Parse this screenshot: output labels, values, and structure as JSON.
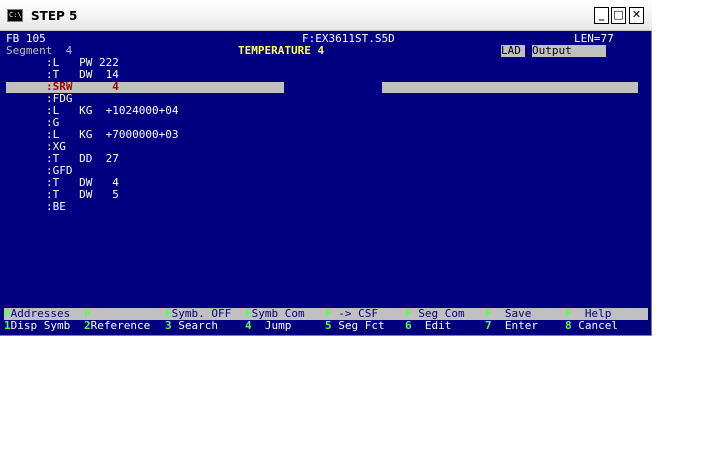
{
  "window": {
    "title": "STEP 5",
    "icon_text": "C:\\",
    "min": "_",
    "max": "□",
    "close": "✕"
  },
  "header": {
    "block": "FB 105",
    "file": "F:EX3611ST.S5D",
    "length": "LEN=77",
    "segment": "Segment  4",
    "segment_title": "TEMPERATURE 4",
    "mode": "LAD",
    "output": "Output"
  },
  "code_lines": [
    ":L   PW 222",
    ":T   DW  14",
    ":SRW      4",
    ":FDG",
    ":L   KG  +1024000+04",
    ":G",
    ":L   KG  +7000000+03",
    ":XG",
    ":T   DD  27",
    ":GFD",
    ":T   DW   4",
    ":T   DW   5",
    ":BE"
  ],
  "fkeys_top": [
    {
      "n": "F",
      "label": "Addresses"
    },
    {
      "n": "F",
      "label": ""
    },
    {
      "n": "F",
      "label": "Symb. OFF"
    },
    {
      "n": "F",
      "label": "Symb Com"
    },
    {
      "n": "F",
      "label": " -> CSF"
    },
    {
      "n": "F",
      "label": " Seg Com"
    },
    {
      "n": "F",
      "label": "  Save"
    },
    {
      "n": "F",
      "label": "  Help"
    }
  ],
  "fkeys_bottom": [
    {
      "n": "1",
      "label": "Disp Symb"
    },
    {
      "n": "2",
      "label": "Reference"
    },
    {
      "n": "3",
      "label": " Search"
    },
    {
      "n": "4",
      "label": "  Jump"
    },
    {
      "n": "5",
      "label": " Seg Fct"
    },
    {
      "n": "6",
      "label": "  Edit"
    },
    {
      "n": "7",
      "label": "  Enter"
    },
    {
      "n": "8",
      "label": " Cancel"
    }
  ],
  "colors": {
    "screen_bg": "#000080",
    "highlight": "#c0c0c0",
    "accent_yellow": "#ffff55",
    "fnum_green": "#55ff55",
    "selected_text": "#aa0000"
  }
}
